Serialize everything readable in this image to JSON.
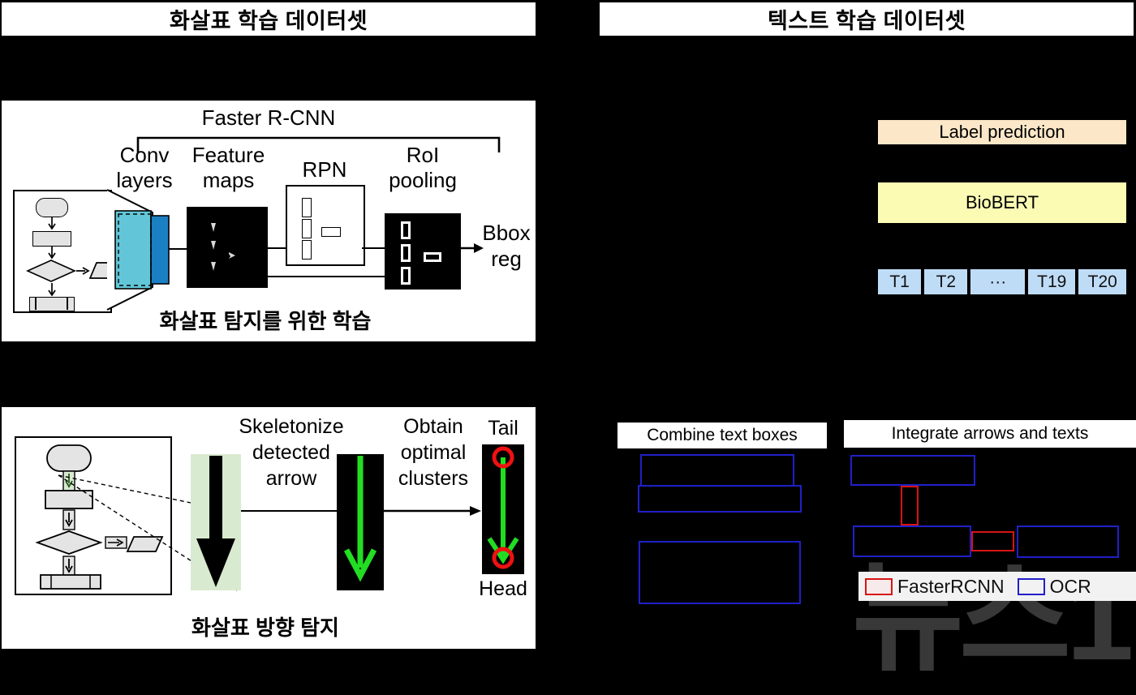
{
  "titles": {
    "left": "화살표 학습 데이터셋",
    "right": "텍스트 학습 데이터셋"
  },
  "faster_rcnn_panel": {
    "header": "Faster R-CNN",
    "stage_conv": "Conv\nlayers",
    "stage_conv_l1": "Conv",
    "stage_conv_l2": "layers",
    "stage_feature_l1": "Feature",
    "stage_feature_l2": "maps",
    "stage_rpn": "RPN",
    "stage_roi_l1": "RoI",
    "stage_roi_l2": "pooling",
    "output_l1": "Bbox",
    "output_l2": "reg",
    "caption": "화살표 탐지를 위한 학습"
  },
  "arrow_direction_panel": {
    "step1_l1": "Skeletonize",
    "step1_l2": "detected",
    "step1_l3": "arrow",
    "step2_l1": "Obtain",
    "step2_l2": "optimal",
    "step2_l3": "clusters",
    "tail_label": "Tail",
    "head_label": "Head",
    "caption": "화살표 방향 탐지"
  },
  "text_model": {
    "label_prediction": "Label prediction",
    "model_name": "BioBERT",
    "tokens": [
      "T1",
      "T2",
      "···",
      "T19",
      "T20"
    ]
  },
  "text_boxes_panel": {
    "combine_title": "Combine text boxes",
    "integrate_title": "Integrate arrows and texts",
    "legend_faster": "FasterRCNN",
    "legend_ocr": "OCR"
  },
  "watermark": "뉴스1",
  "colors": {
    "background": "#000000",
    "panel": "#ffffff",
    "label_prediction_bg": "#fce8c8",
    "biobert_bg": "#fbfbb4",
    "token_bg": "#bfdcf7",
    "ocr_blue": "#2020c8",
    "fasterrcnn_red": "#d81414",
    "arrow_green": "#22dd22",
    "conv_light": "#62c6d8",
    "conv_dark": "#1b7fc4",
    "highlight_green": "#d8ead0"
  }
}
